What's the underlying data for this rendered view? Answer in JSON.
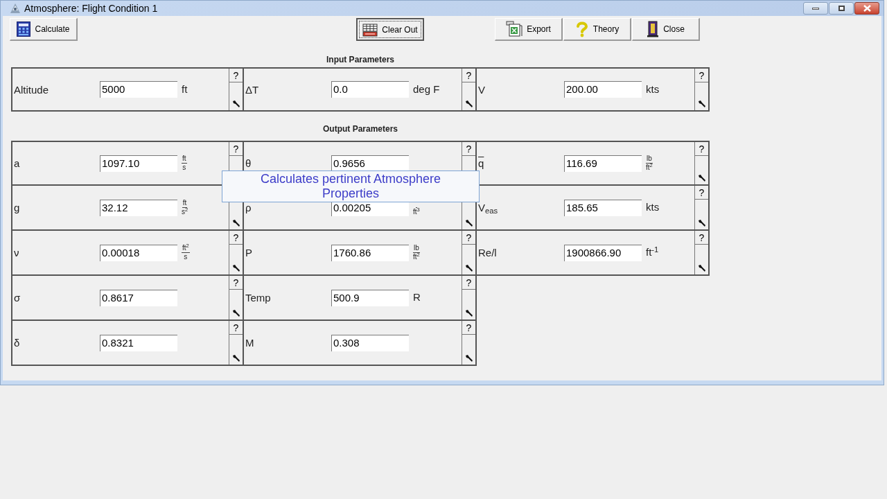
{
  "window": {
    "title": "Atmosphere: Flight Condition 1"
  },
  "toolbar": [
    {
      "label": "Calculate",
      "kind": "calculate",
      "focused": false
    },
    {
      "label": "Clear Out",
      "kind": "clear",
      "focused": true
    },
    {
      "label": "Export",
      "kind": "export",
      "focused": false
    },
    {
      "label": "Theory",
      "kind": "theory",
      "focused": false
    },
    {
      "label": "Close",
      "kind": "close",
      "focused": false
    }
  ],
  "input_heading": "Input Parameters",
  "input_rows": [
    [
      {
        "label": "Altitude",
        "value": "5000",
        "unit": "ft",
        "help": "?"
      },
      {
        "label": "ΔT",
        "value": "0.0",
        "unit": "deg F",
        "help": "?"
      },
      {
        "label": "V",
        "value": "200.00",
        "unit": "kts",
        "help": "?"
      }
    ]
  ],
  "output_heading": "Output Parameters",
  "output_rows": [
    [
      {
        "label": "a",
        "value": "1097.10",
        "unit": {
          "num": "ft",
          "den": "s"
        },
        "help": "?",
        "wrench_hidden": true
      },
      {
        "label": "θ",
        "value": "0.9656",
        "help": "?",
        "wrench_hidden": true
      },
      {
        "label": "q",
        "overline": true,
        "value": "116.69",
        "unit": {
          "num": "lb",
          "den": "ft$^{2}$"
        },
        "help": "?"
      }
    ],
    [
      {
        "label": "g",
        "value": "32.12",
        "unit": {
          "num": "ft",
          "den": "s$^{2}$"
        }
      },
      {
        "label": "ρ",
        "value": "0.00205",
        "unit": {
          "den": "ft$^{3}$"
        }
      },
      {
        "label": "V$_{eas}$",
        "value": "185.65",
        "unit": "kts",
        "help": "?"
      }
    ],
    [
      {
        "label": "ν",
        "value": "0.00018",
        "unit": {
          "num": "ft$^{2}$",
          "den": "s"
        },
        "help": "?"
      },
      {
        "label": "P",
        "value": "1760.86",
        "unit": {
          "num": "lb",
          "den": "ft$^{2}$"
        },
        "help": "?"
      },
      {
        "label": "Re/l",
        "value": "1900866.90",
        "unit": "ft$^{-1}$",
        "help": "?"
      }
    ],
    [
      {
        "label": "σ",
        "value": "0.8617",
        "help": "?"
      },
      {
        "label": "Temp",
        "value": "500.9",
        "unit": "R",
        "help": "?"
      }
    ],
    [
      {
        "label": "δ",
        "value": "0.8321",
        "help": "?"
      },
      {
        "label": "M",
        "value": "0.308",
        "help": "?"
      }
    ]
  ],
  "tooltip": "Calculates pertinent Atmosphere Properties"
}
